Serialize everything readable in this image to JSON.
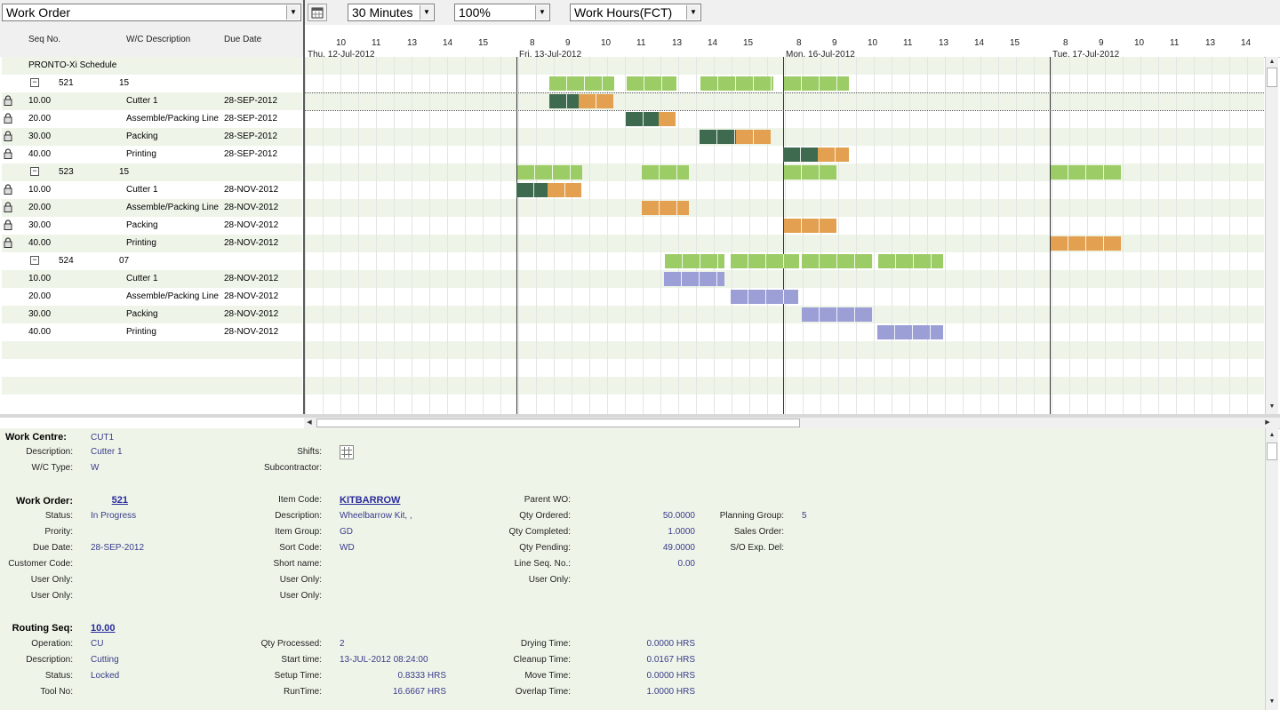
{
  "toolbar": {
    "view_select": "Work Order",
    "interval_select": "30 Minutes",
    "zoom_select": "100%",
    "calendar_select": "Work Hours(FCT)"
  },
  "columns": {
    "seq": "Seq No.",
    "wc": "W/C Description",
    "due": "Due Date"
  },
  "days": [
    {
      "label": "Thu, 12-Jul-2012",
      "hours": [
        "10",
        "11",
        "13",
        "14",
        "15"
      ]
    },
    {
      "label": "Fri, 13-Jul-2012",
      "hours": [
        "8",
        "9",
        "10",
        "11",
        "13",
        "14",
        "15"
      ]
    },
    {
      "label": "Mon, 16-Jul-2012",
      "hours": [
        "8",
        "9",
        "10",
        "11",
        "13",
        "14",
        "15"
      ]
    },
    {
      "label": "Tue, 17-Jul-2012",
      "hours": [
        "8",
        "9",
        "10",
        "11",
        "13",
        "14"
      ]
    }
  ],
  "schedule": {
    "root": "PRONTO-Xi Schedule",
    "orders": [
      {
        "wo": "521",
        "pg": "15",
        "ops": [
          {
            "seq": "10.00",
            "wc": "Cutter 1",
            "due": "28-SEP-2012",
            "locked": true
          },
          {
            "seq": "20.00",
            "wc": "Assemble/Packing Line",
            "due": "28-SEP-2012",
            "locked": true
          },
          {
            "seq": "30.00",
            "wc": "Packing",
            "due": "28-SEP-2012",
            "locked": true
          },
          {
            "seq": "40.00",
            "wc": "Printing",
            "due": "28-SEP-2012",
            "locked": true
          }
        ]
      },
      {
        "wo": "523",
        "pg": "15",
        "ops": [
          {
            "seq": "10.00",
            "wc": "Cutter 1",
            "due": "28-NOV-2012",
            "locked": true
          },
          {
            "seq": "20.00",
            "wc": "Assemble/Packing Line",
            "due": "28-NOV-2012",
            "locked": true
          },
          {
            "seq": "30.00",
            "wc": "Packing",
            "due": "28-NOV-2012",
            "locked": true
          },
          {
            "seq": "40.00",
            "wc": "Printing",
            "due": "28-NOV-2012",
            "locked": true
          }
        ]
      },
      {
        "wo": "524",
        "pg": "07",
        "ops": [
          {
            "seq": "10.00",
            "wc": "Cutter 1",
            "due": "28-NOV-2012",
            "locked": false
          },
          {
            "seq": "20.00",
            "wc": "Assemble/Packing Line",
            "due": "28-NOV-2012",
            "locked": false
          },
          {
            "seq": "30.00",
            "wc": "Packing",
            "due": "28-NOV-2012",
            "locked": false
          },
          {
            "seq": "40.00",
            "wc": "Printing",
            "due": "28-NOV-2012",
            "locked": false
          }
        ]
      }
    ]
  },
  "colors": {
    "summary": "#9ccc65",
    "done": "#3e6b4f",
    "pending": "#e2a050",
    "unlocked": "#9b9fd6",
    "row_alt": "#eef5e8"
  },
  "details": {
    "work_centre": {
      "label": "Work Centre:",
      "value": "CUT1"
    },
    "wc_description": {
      "label": "Description:",
      "value": "Cutter 1"
    },
    "wc_type": {
      "label": "W/C Type:",
      "value": "W"
    },
    "shifts": {
      "label": "Shifts:"
    },
    "subcontractor": {
      "label": "Subcontractor:"
    },
    "work_order": {
      "label": "Work Order:",
      "value": "521"
    },
    "status": {
      "label": "Status:",
      "value": "In Progress"
    },
    "priority": {
      "label": "Prority:"
    },
    "due_date": {
      "label": "Due Date:",
      "value": "28-SEP-2012"
    },
    "customer_code": {
      "label": "Customer Code:"
    },
    "user_only_1": {
      "label": "User Only:"
    },
    "user_only_2": {
      "label": "User Only:"
    },
    "item_code": {
      "label": "Item Code:",
      "value": "KITBARROW"
    },
    "item_description": {
      "label": "Description:",
      "value": "Wheelbarrow Kit, ,"
    },
    "item_group": {
      "label": "Item Group:",
      "value": "GD"
    },
    "sort_code": {
      "label": "Sort Code:",
      "value": "WD"
    },
    "short_name": {
      "label": "Short name:"
    },
    "user_only_3": {
      "label": "User Only:"
    },
    "user_only_4": {
      "label": "User Only:"
    },
    "parent_wo": {
      "label": "Parent WO:"
    },
    "qty_ordered": {
      "label": "Qty Ordered:",
      "value": "50.0000"
    },
    "qty_completed": {
      "label": "Qty Completed:",
      "value": "1.0000"
    },
    "qty_pending": {
      "label": "Qty Pending:",
      "value": "49.0000"
    },
    "line_seq": {
      "label": "Line Seq. No.:",
      "value": "0.00"
    },
    "user_only_5": {
      "label": "User Only:"
    },
    "planning_group": {
      "label": "Planning Group:",
      "value": "5"
    },
    "sales_order": {
      "label": "Sales Order:"
    },
    "so_exp_del": {
      "label": "S/O Exp. Del:"
    },
    "routing_seq": {
      "label": "Routing Seq:",
      "value": "10.00"
    },
    "operation": {
      "label": "Operation:",
      "value": "CU"
    },
    "op_description": {
      "label": "Description:",
      "value": "Cutting"
    },
    "op_status": {
      "label": "Status:",
      "value": "Locked"
    },
    "tool_no": {
      "label": "Tool No:"
    },
    "qty_processed": {
      "label": "Qty Processed:",
      "value": "2"
    },
    "start_time": {
      "label": "Start time:",
      "value": "13-JUL-2012 08:24:00"
    },
    "setup_time": {
      "label": "Setup Time:",
      "value": "0.8333 HRS"
    },
    "run_time": {
      "label": "RunTime:",
      "value": "16.6667 HRS"
    },
    "drying_time": {
      "label": "Drying Time:",
      "value": "0.0000 HRS"
    },
    "cleanup_time": {
      "label": "Cleanup Time:",
      "value": "0.0167 HRS"
    },
    "move_time": {
      "label": "Move Time:",
      "value": "0.0000 HRS"
    },
    "overlap_time": {
      "label": "Overlap Time:",
      "value": "1.0000 HRS"
    }
  }
}
